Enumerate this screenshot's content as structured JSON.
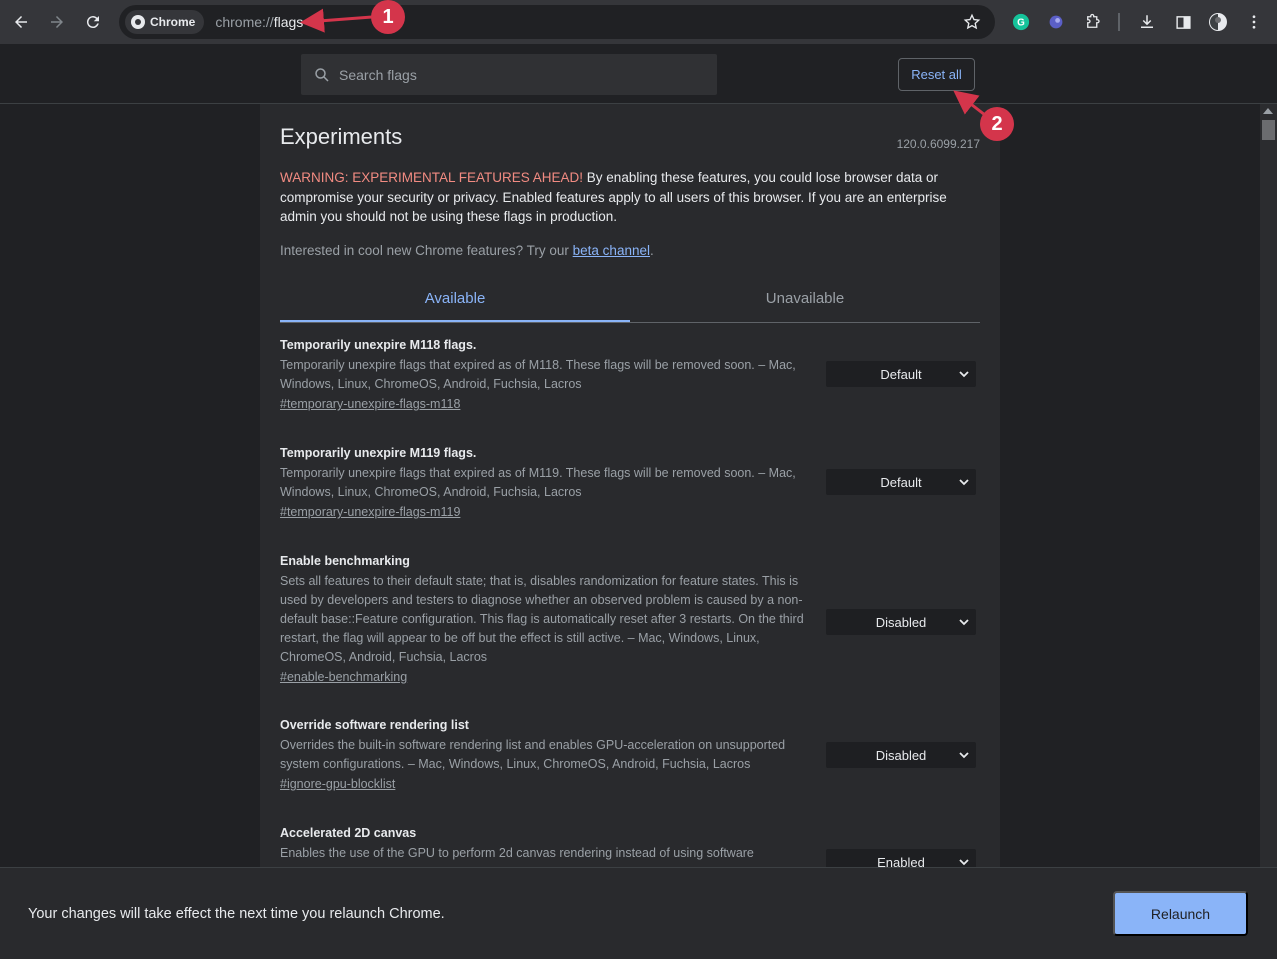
{
  "browser": {
    "chip_label": "Chrome",
    "url_prefix": "chrome://",
    "url_path": "flags"
  },
  "header": {
    "search_placeholder": "Search flags",
    "reset_label": "Reset all"
  },
  "page": {
    "title": "Experiments",
    "version": "120.0.6099.217",
    "warning_label": "WARNING: EXPERIMENTAL FEATURES AHEAD!",
    "warning_text": " By enabling these features, you could lose browser data or compromise your security or privacy. Enabled features apply to all users of this browser. If you are an enterprise admin you should not be using these flags in production.",
    "interested_text": "Interested in cool new Chrome features? Try our ",
    "beta_link": "beta channel",
    "interested_end": ".",
    "tabs": [
      {
        "label": "Available"
      },
      {
        "label": "Unavailable"
      }
    ]
  },
  "flags": [
    {
      "name": "Temporarily unexpire M118 flags.",
      "description": "Temporarily unexpire flags that expired as of M118. These flags will be removed soon. – Mac, Windows, Linux, ChromeOS, Android, Fuchsia, Lacros",
      "link": "#temporary-unexpire-flags-m118",
      "value": "Default"
    },
    {
      "name": "Temporarily unexpire M119 flags.",
      "description": "Temporarily unexpire flags that expired as of M119. These flags will be removed soon. – Mac, Windows, Linux, ChromeOS, Android, Fuchsia, Lacros",
      "link": "#temporary-unexpire-flags-m119",
      "value": "Default"
    },
    {
      "name": "Enable benchmarking",
      "description": "Sets all features to their default state; that is, disables randomization for feature states. This is used by developers and testers to diagnose whether an observed problem is caused by a non-default base::Feature configuration. This flag is automatically reset after 3 restarts. On the third restart, the flag will appear to be off but the effect is still active. – Mac, Windows, Linux, ChromeOS, Android, Fuchsia, Lacros",
      "link": "#enable-benchmarking",
      "value": "Disabled"
    },
    {
      "name": "Override software rendering list",
      "description": "Overrides the built-in software rendering list and enables GPU-acceleration on unsupported system configurations. – Mac, Windows, Linux, ChromeOS, Android, Fuchsia, Lacros",
      "link": "#ignore-gpu-blocklist",
      "value": "Disabled"
    },
    {
      "name": "Accelerated 2D canvas",
      "description": "Enables the use of the GPU to perform 2d canvas rendering instead of using software",
      "value": "Enabled"
    }
  ],
  "bottom_bar": {
    "message": "Your changes will take effect the next time you relaunch Chrome.",
    "relaunch_label": "Relaunch"
  },
  "annotations": {
    "badge_1": "1",
    "badge_2": "2"
  },
  "colors": {
    "accent": "#8ab4f8",
    "warning": "#f28b82",
    "annotation": "#d4354b"
  }
}
